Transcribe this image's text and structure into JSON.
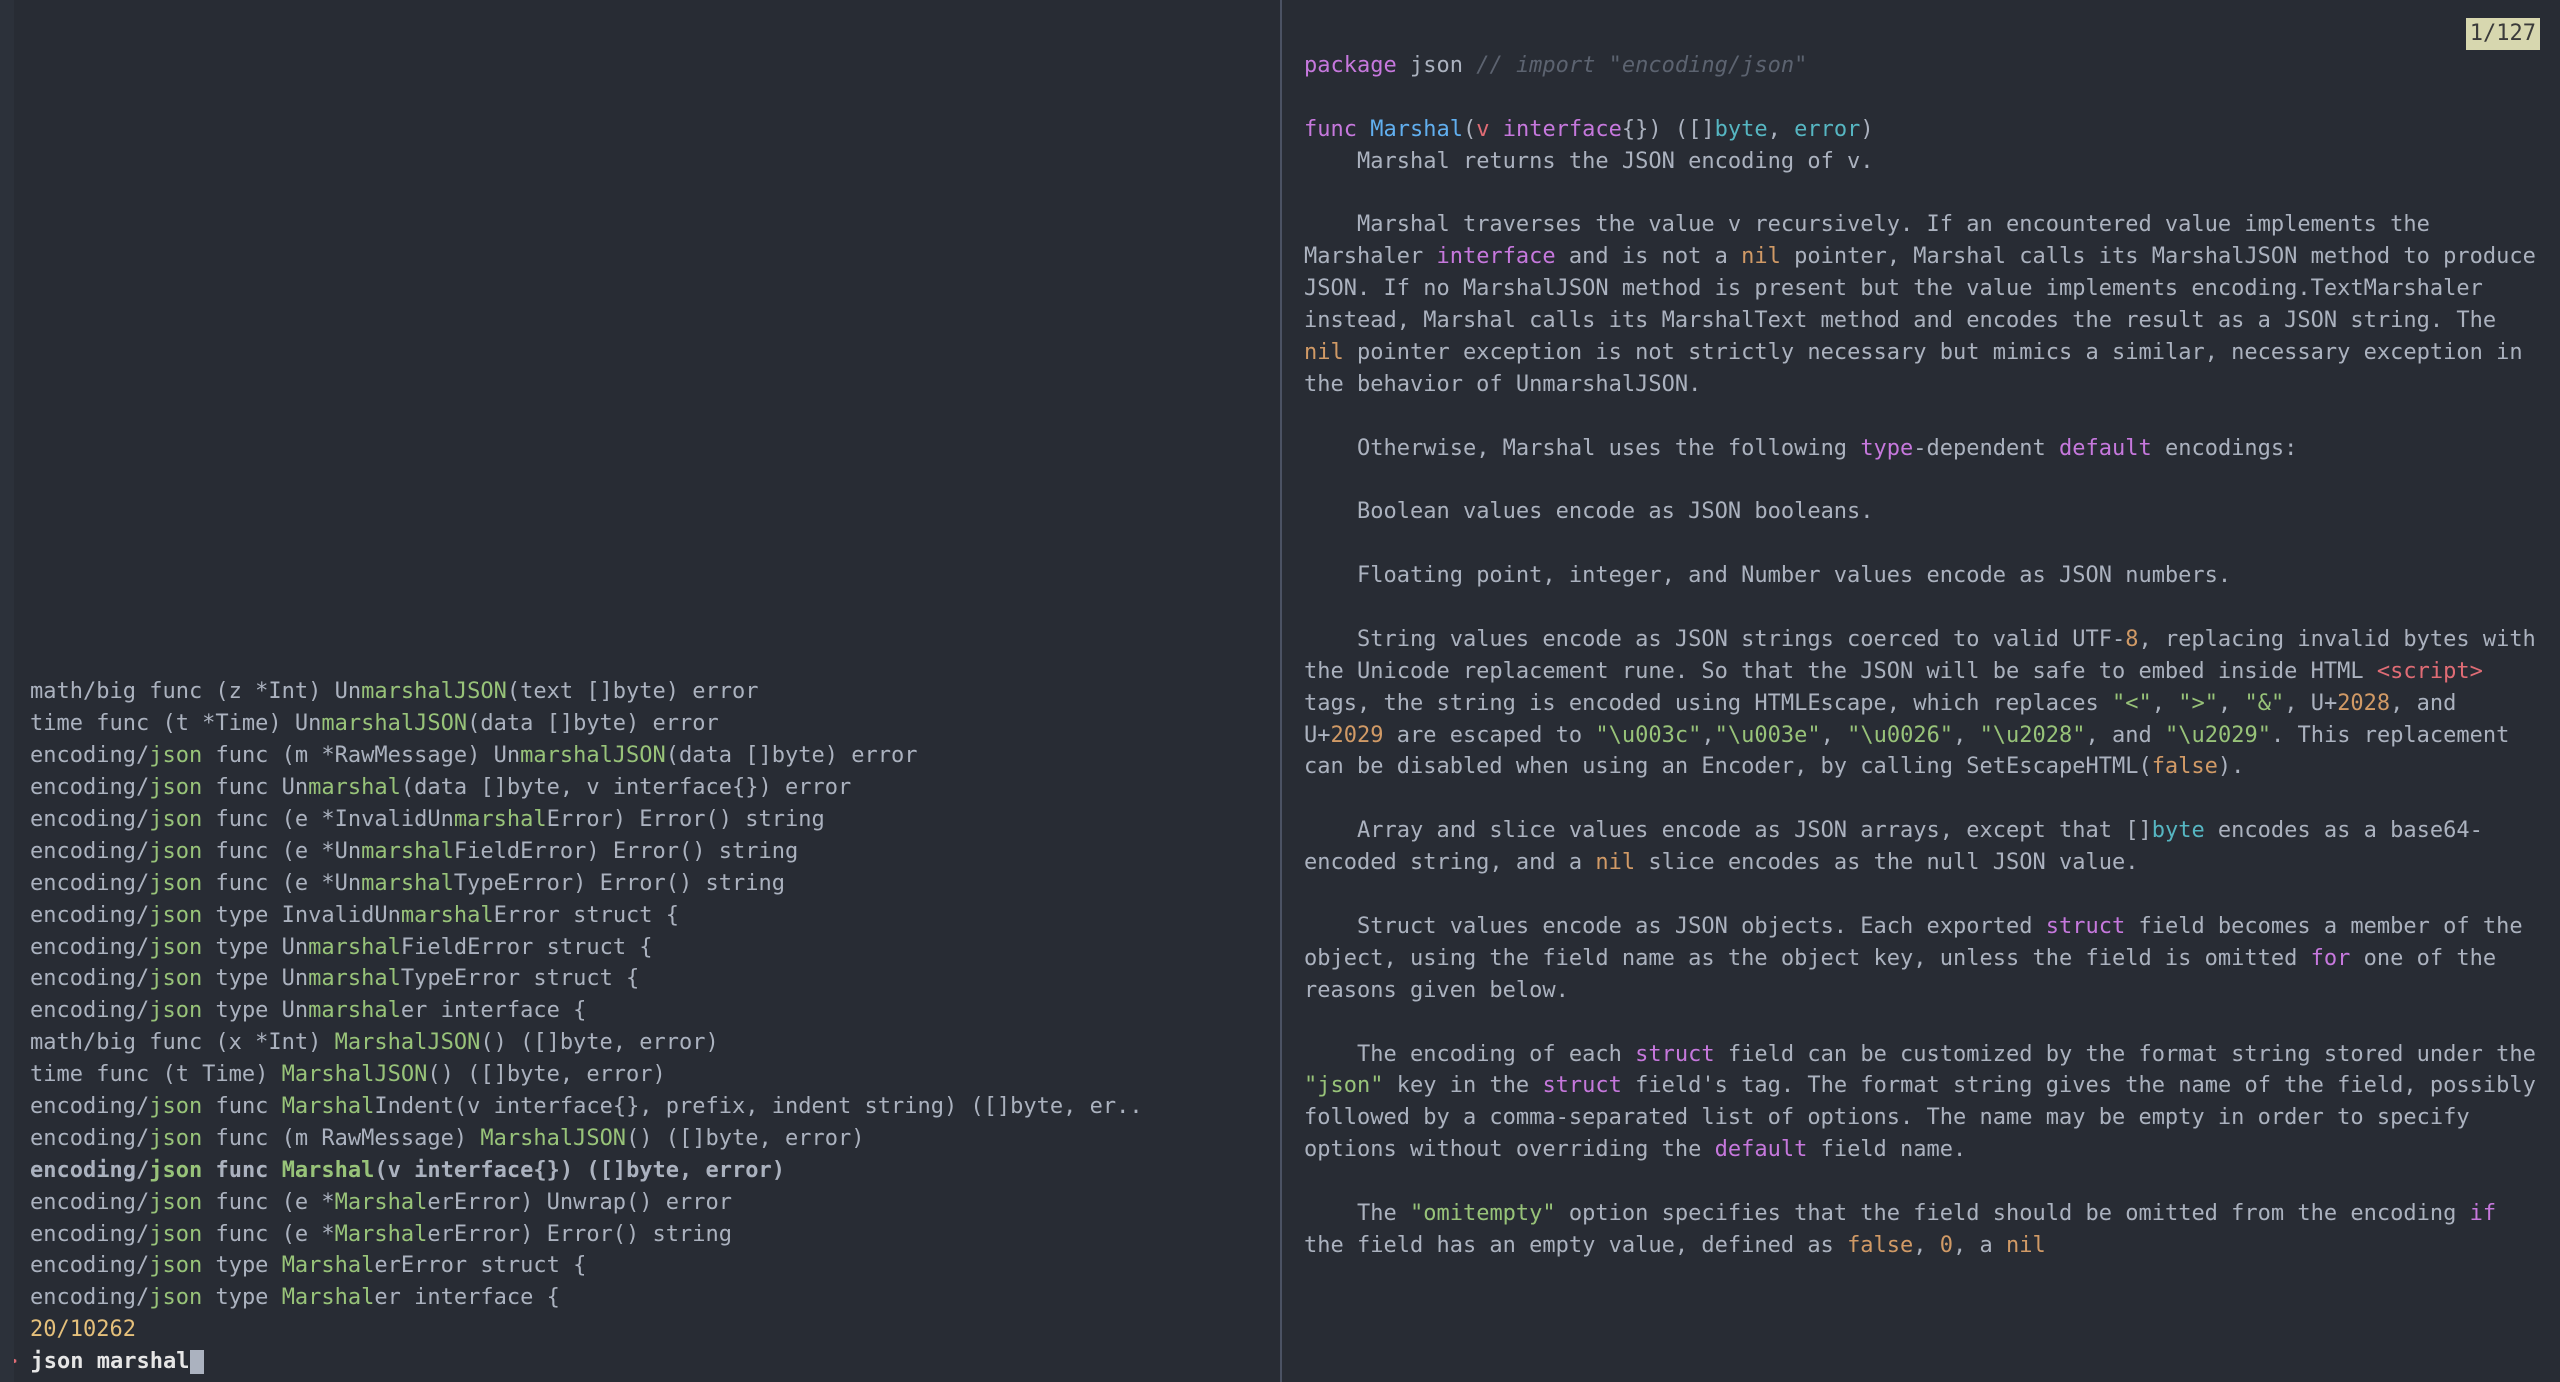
{
  "left": {
    "lines": [
      {
        "prefix": "math/big func (z *Int) Un",
        "hl": "marshalJSON",
        "suffix": "(text []byte) error"
      },
      {
        "prefix": "time func (t *Time) Un",
        "hl": "marshalJSON",
        "suffix": "(data []byte) error"
      },
      {
        "prefix": "encoding/",
        "hl": "json",
        "mid": " func (m *RawMessage) Un",
        "hl2": "marshalJSON",
        "suffix": "(data []byte) error"
      },
      {
        "prefix": "encoding/",
        "hl": "json",
        "mid": " func Un",
        "hl2": "marshal",
        "suffix": "(data []byte, v interface{}) error"
      },
      {
        "prefix": "encoding/",
        "hl": "json",
        "mid": " func (e *InvalidUn",
        "hl2": "marshal",
        "suffix": "Error) Error() string"
      },
      {
        "prefix": "encoding/",
        "hl": "json",
        "mid": " func (e *Un",
        "hl2": "marshal",
        "suffix": "FieldError) Error() string"
      },
      {
        "prefix": "encoding/",
        "hl": "json",
        "mid": " func (e *Un",
        "hl2": "marshal",
        "suffix": "TypeError) Error() string"
      },
      {
        "prefix": "encoding/",
        "hl": "json",
        "mid": " type InvalidUn",
        "hl2": "marshal",
        "suffix": "Error struct {"
      },
      {
        "prefix": "encoding/",
        "hl": "json",
        "mid": " type Un",
        "hl2": "marshal",
        "suffix": "FieldError struct {"
      },
      {
        "prefix": "encoding/",
        "hl": "json",
        "mid": " type Un",
        "hl2": "marshal",
        "suffix": "TypeError struct {"
      },
      {
        "prefix": "encoding/",
        "hl": "json",
        "mid": " type Un",
        "hl2": "marshal",
        "suffix": "er interface {"
      },
      {
        "prefix": "math/big func (x *Int) ",
        "hl": "MarshalJSON",
        "suffix": "() ([]byte, error)"
      },
      {
        "prefix": "time func (t Time) ",
        "hl": "MarshalJSON",
        "suffix": "() ([]byte, error)"
      },
      {
        "prefix": "encoding/",
        "hl": "json",
        "mid": " func ",
        "hl2": "Marshal",
        "suffix": "Indent(v interface{}, prefix, indent string) ([]byte, er.."
      },
      {
        "prefix": "encoding/",
        "hl": "json",
        "mid": " func (m RawMessage) ",
        "hl2": "MarshalJSON",
        "suffix": "() ([]byte, error)"
      },
      {
        "selected": true,
        "prefix": "encoding/",
        "hl": "json",
        "mid": " func ",
        "hl2": "Marshal",
        "suffix": "(v interface{}) ([]byte, error)"
      },
      {
        "prefix": "encoding/",
        "hl": "json",
        "mid": " func (e *",
        "hl2": "Marshal",
        "suffix": "erError) Unwrap() error"
      },
      {
        "prefix": "encoding/",
        "hl": "json",
        "mid": " func (e *",
        "hl2": "Marshal",
        "suffix": "erError) Error() string"
      },
      {
        "prefix": "encoding/",
        "hl": "json",
        "mid": " type ",
        "hl2": "Marshal",
        "suffix": "erError struct {"
      },
      {
        "prefix": "encoding/",
        "hl": "json",
        "mid": " type ",
        "hl2": "Marshal",
        "suffix": "er interface {"
      }
    ],
    "status": "20/10262",
    "prompt_caret": ">",
    "query": "json marshal"
  },
  "right": {
    "match_count": "1/127",
    "package_kw": "package",
    "package_name": "json",
    "import_comment": "// import \"encoding/json\"",
    "func_kw": "func",
    "func_name": "Marshal",
    "func_sig_params_open": "(",
    "func_param_v": "v",
    "func_param_type": "interface",
    "func_sig_rest": "{}) ([]",
    "byte_t": "byte",
    "sig_sep": ", ",
    "error_t": "error",
    "sig_close": ")",
    "para1": "Marshal returns the JSON encoding of v.",
    "para2a": "Marshal traverses the value v recursively. If an encountered value implements the Marshaler ",
    "interface_kw": "interface",
    "para2b": " and is not a ",
    "nil_kw": "nil",
    "para2c": " pointer, Marshal calls its MarshalJSON method to produce JSON. If no MarshalJSON method is present but the value implements encoding.TextMarshaler instead, Marshal calls its MarshalText method and encodes the result as a JSON string. The ",
    "para2d": " pointer exception is not strictly necessary but mimics a similar, necessary exception in the behavior of UnmarshalJSON.",
    "para3a": "Otherwise, Marshal uses the following ",
    "type_kw": "type",
    "para3b": "-dependent ",
    "default_kw": "default",
    "para3c": " encodings:",
    "para4": "Boolean values encode as JSON booleans.",
    "para5": "Floating point, integer, and Number values encode as JSON numbers.",
    "para6a": "String values encode as JSON strings coerced to valid UTF-",
    "num8": "8",
    "para6b": ", replacing invalid bytes with the Unicode replacement rune. So that the JSON will be safe to embed inside HTML ",
    "script_tag": "<script>",
    "para6c": " tags, the string is encoded using HTMLEscape, which replaces ",
    "lt": "\"<\"",
    "comma": ", ",
    "gt": "\">\"",
    "amp": "\"&\"",
    "u2028pre": ", U+",
    "u2028num": "2028",
    "andword": ", and U+",
    "u2029num": "2029",
    "para6d": " are escaped to ",
    "esc1": "\"\\u003c\"",
    "esc2": "\"\\u003e\"",
    "esc3": "\"\\u0026\"",
    "esc4": "\"\\u2028\"",
    "andword2": ", and ",
    "esc5": "\"\\u2029\"",
    "para6e": ". This replacement can be disabled when using an Encoder, by calling SetEscapeHTML(",
    "false_kw": "false",
    "para6f": ").",
    "para7a": "Array and slice values encode as JSON arrays, except that []",
    "para7b": " encodes as a base64-encoded string, and a ",
    "para7c": " slice encodes as the null JSON value.",
    "para8a": "Struct values encode as JSON objects. Each exported ",
    "struct_kw": "struct",
    "para8b": " field becomes a member of the object, using the field name as the object key, unless the field is omitted ",
    "for_kw": "for",
    "para8c": " one of the reasons given below.",
    "para9a": "The encoding of each ",
    "para9b": " field can be customized by the format string stored under the ",
    "json_str": "\"json\"",
    "para9c": " key in the ",
    "para9d": " field's tag. The format string gives the name of the field, possibly followed by a comma-separated list of options. The name may be empty in order to specify options without overriding the ",
    "para9e": " field name.",
    "para10a": "The ",
    "omitempty": "\"omitempty\"",
    "para10b": " option specifies that the field should be omitted from the encoding ",
    "if_kw": "if",
    "para10c": " the field has an empty value, defined as ",
    "zero": "0",
    "para10d": ", a "
  }
}
